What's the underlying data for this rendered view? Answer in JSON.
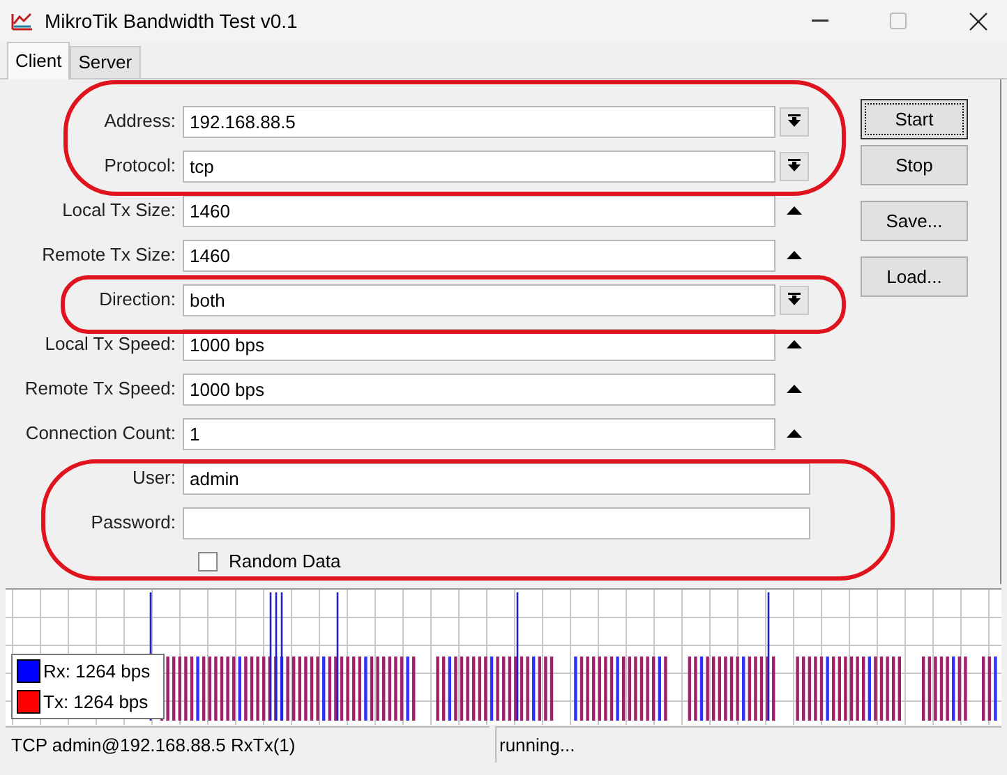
{
  "window": {
    "title": "MikroTik Bandwidth Test v0.1"
  },
  "tabs": [
    {
      "label": "Client",
      "selected": true
    },
    {
      "label": "Server",
      "selected": false
    }
  ],
  "fields": [
    {
      "label": "Address:",
      "value": "192.168.88.5",
      "kind": "combo"
    },
    {
      "label": "Protocol:",
      "value": "tcp",
      "kind": "combo"
    },
    {
      "label": "Local Tx Size:",
      "value": "1460",
      "kind": "spin"
    },
    {
      "label": "Remote Tx Size:",
      "value": "1460",
      "kind": "spin"
    },
    {
      "label": "Direction:",
      "value": "both",
      "kind": "combo"
    },
    {
      "label": "Local Tx Speed:",
      "value": "1000 bps",
      "kind": "spin"
    },
    {
      "label": "Remote Tx Speed:",
      "value": "1000 bps",
      "kind": "spin"
    },
    {
      "label": "Connection Count:",
      "value": "1",
      "kind": "spin"
    },
    {
      "label": "User:",
      "value": "admin",
      "kind": "text"
    },
    {
      "label": "Password:",
      "kind": "text"
    }
  ],
  "random_data": {
    "label": "Random Data",
    "checked": false
  },
  "buttons": [
    "Start",
    "Stop",
    "Save...",
    "Load..."
  ],
  "legend": [
    {
      "label": "Rx: 1264 bps",
      "color": "#0000ff"
    },
    {
      "label": "Tx: 1264 bps",
      "color": "#ff0000"
    }
  ],
  "status_bar": [
    "TCP admin@192.168.88.5 RxTx(1)",
    "running..."
  ]
}
